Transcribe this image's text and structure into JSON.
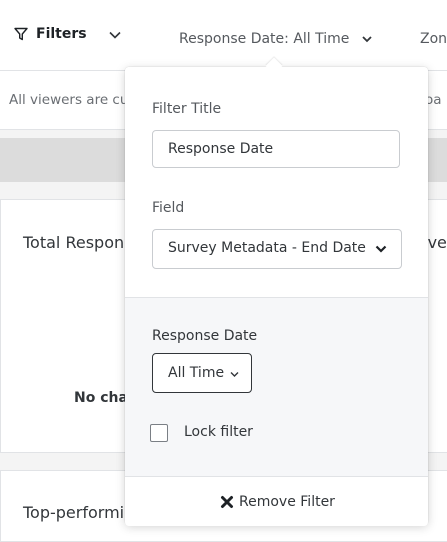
{
  "topbar": {
    "filters_label": "Filters",
    "date_filter_label": "Response Date: All Time",
    "next_filter_label": "Zon"
  },
  "notice": {
    "text": "All viewers are cu",
    "text_right": "oa"
  },
  "cards": {
    "card1_title": "Total Respon",
    "card1_title_right": "rve",
    "card1_empty": "No cha",
    "card2_title": "Top-performir"
  },
  "popover": {
    "filter_title_label": "Filter Title",
    "filter_title_value": "Response Date",
    "field_label": "Field",
    "field_value": "Survey Metadata - End Date",
    "response_date_label": "Response Date",
    "time_value": "All Time",
    "lock_label": "Lock filter",
    "lock_checked": false,
    "remove_label": "Remove Filter"
  },
  "icons": [
    "funnel-icon",
    "chevron-down-icon",
    "close-icon"
  ],
  "colors": {
    "text": "#32363a",
    "border": "#c9ccd0",
    "panel_bg": "#f6f7f9",
    "page_bg": "#f4f4f4"
  }
}
